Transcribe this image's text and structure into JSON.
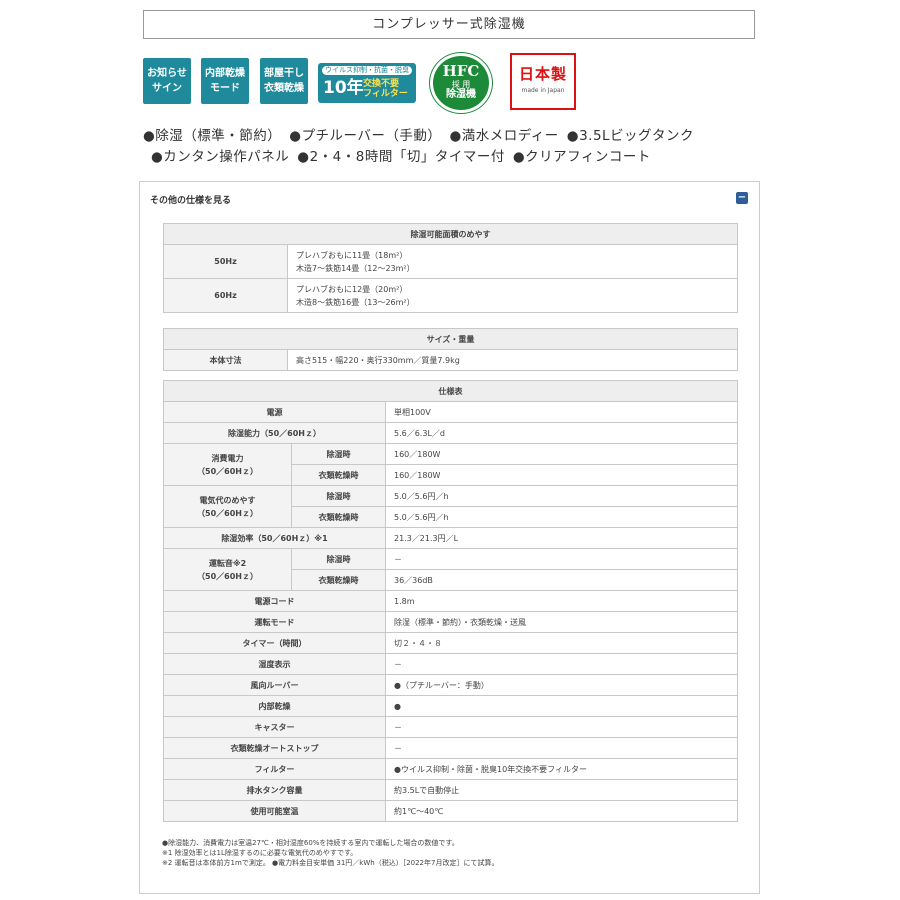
{
  "title": "コンプレッサー式除湿機",
  "badges": {
    "notice": [
      "お知らせ",
      "サイン"
    ],
    "drying": [
      "内部乾燥",
      "モード"
    ],
    "laundry": [
      "部屋干し",
      "衣類乾燥"
    ],
    "filter": {
      "top": "ウイルス抑制・抗菌・脱臭",
      "num": "10年",
      "rest1": "交換不要",
      "rest2": "フィルター"
    },
    "hfc": {
      "big": "HFC",
      "small": "採 用",
      "bottom": "除湿機"
    },
    "japan": {
      "big": "日本製",
      "small": "made in Japan"
    }
  },
  "features": [
    "除湿（標準・節約）",
    "プチルーバー（手動）",
    "満水メロディー",
    "3.5Lビッグタンク",
    "カンタン操作パネル",
    "2・4・8時間「切」タイマー付",
    "クリアフィンコート"
  ],
  "spec_toggle_label": "その他の仕様を見る",
  "toggle_symbol": "−",
  "area_table": {
    "header": "除湿可能面積のめやす",
    "rows": [
      {
        "label": "50Hz",
        "line1": "プレハブおもに11畳（18m²）",
        "line2": "木造7～鉄筋14畳（12～23m²）"
      },
      {
        "label": "60Hz",
        "line1": "プレハブおもに12畳（20m²）",
        "line2": "木造8～鉄筋16畳（13～26m²）"
      }
    ]
  },
  "size_table": {
    "header": "サイズ・重量",
    "label": "本体寸法",
    "value": "高さ515・幅220・奥行330mm／質量7.9kg"
  },
  "spec_table": {
    "header": "仕様表",
    "power": {
      "label": "電源",
      "value": "単相100V"
    },
    "capacity": {
      "label": "除湿能力（50／60Hｚ）",
      "value": "5.6／6.3L／d"
    },
    "consumption": {
      "label1": "消費電力",
      "label2": "（50／60Hｚ）",
      "sub1": "除湿時",
      "val1": "160／180W",
      "sub2": "衣類乾燥時",
      "val2": "160／180W"
    },
    "cost": {
      "label1": "電気代のめやす",
      "label2": "（50／60Hｚ）",
      "sub1": "除湿時",
      "val1": "5.0／5.6円／h",
      "sub2": "衣類乾燥時",
      "val2": "5.0／5.6円／h"
    },
    "efficiency": {
      "label": "除湿効率（50／60Hｚ）※1",
      "value": "21.3／21.3円／L"
    },
    "noise": {
      "label1": "運転音※2",
      "label2": "（50／60Hｚ）",
      "sub1": "除湿時",
      "val1": "－",
      "sub2": "衣類乾燥時",
      "val2": "36／36dB"
    },
    "rows": [
      {
        "label": "電源コード",
        "value": "1.8m"
      },
      {
        "label": "運転モード",
        "value": "除湿（標準・節約）・衣類乾燥・送風"
      },
      {
        "label": "タイマー（時間）",
        "value": "切２・４・８"
      },
      {
        "label": "湿度表示",
        "value": "－"
      },
      {
        "label": "風向ルーバー",
        "value": "●（プチルーバー：手動）"
      },
      {
        "label": "内部乾燥",
        "value": "●"
      },
      {
        "label": "キャスター",
        "value": "－"
      },
      {
        "label": "衣類乾燥オートストップ",
        "value": "－"
      },
      {
        "label": "フィルター",
        "value": "●ウイルス抑制・除菌・脱臭10年交換不要フィルター"
      },
      {
        "label": "排水タンク容量",
        "value": "約3.5Lで自動停止"
      },
      {
        "label": "使用可能室温",
        "value": "約1℃～40℃"
      }
    ]
  },
  "notes": [
    "●除湿能力、消費電力は室温27℃・相対湿度60%を持続する室内で運転した場合の数値です。",
    "※1 除湿効率とは1L除湿するのに必要な電気代のめやすです。",
    "※2 運転音は本体前方1mで測定。 ●電力料金目安単価 31円／kWh（税込）［2022年7月改定］にて試算。"
  ]
}
